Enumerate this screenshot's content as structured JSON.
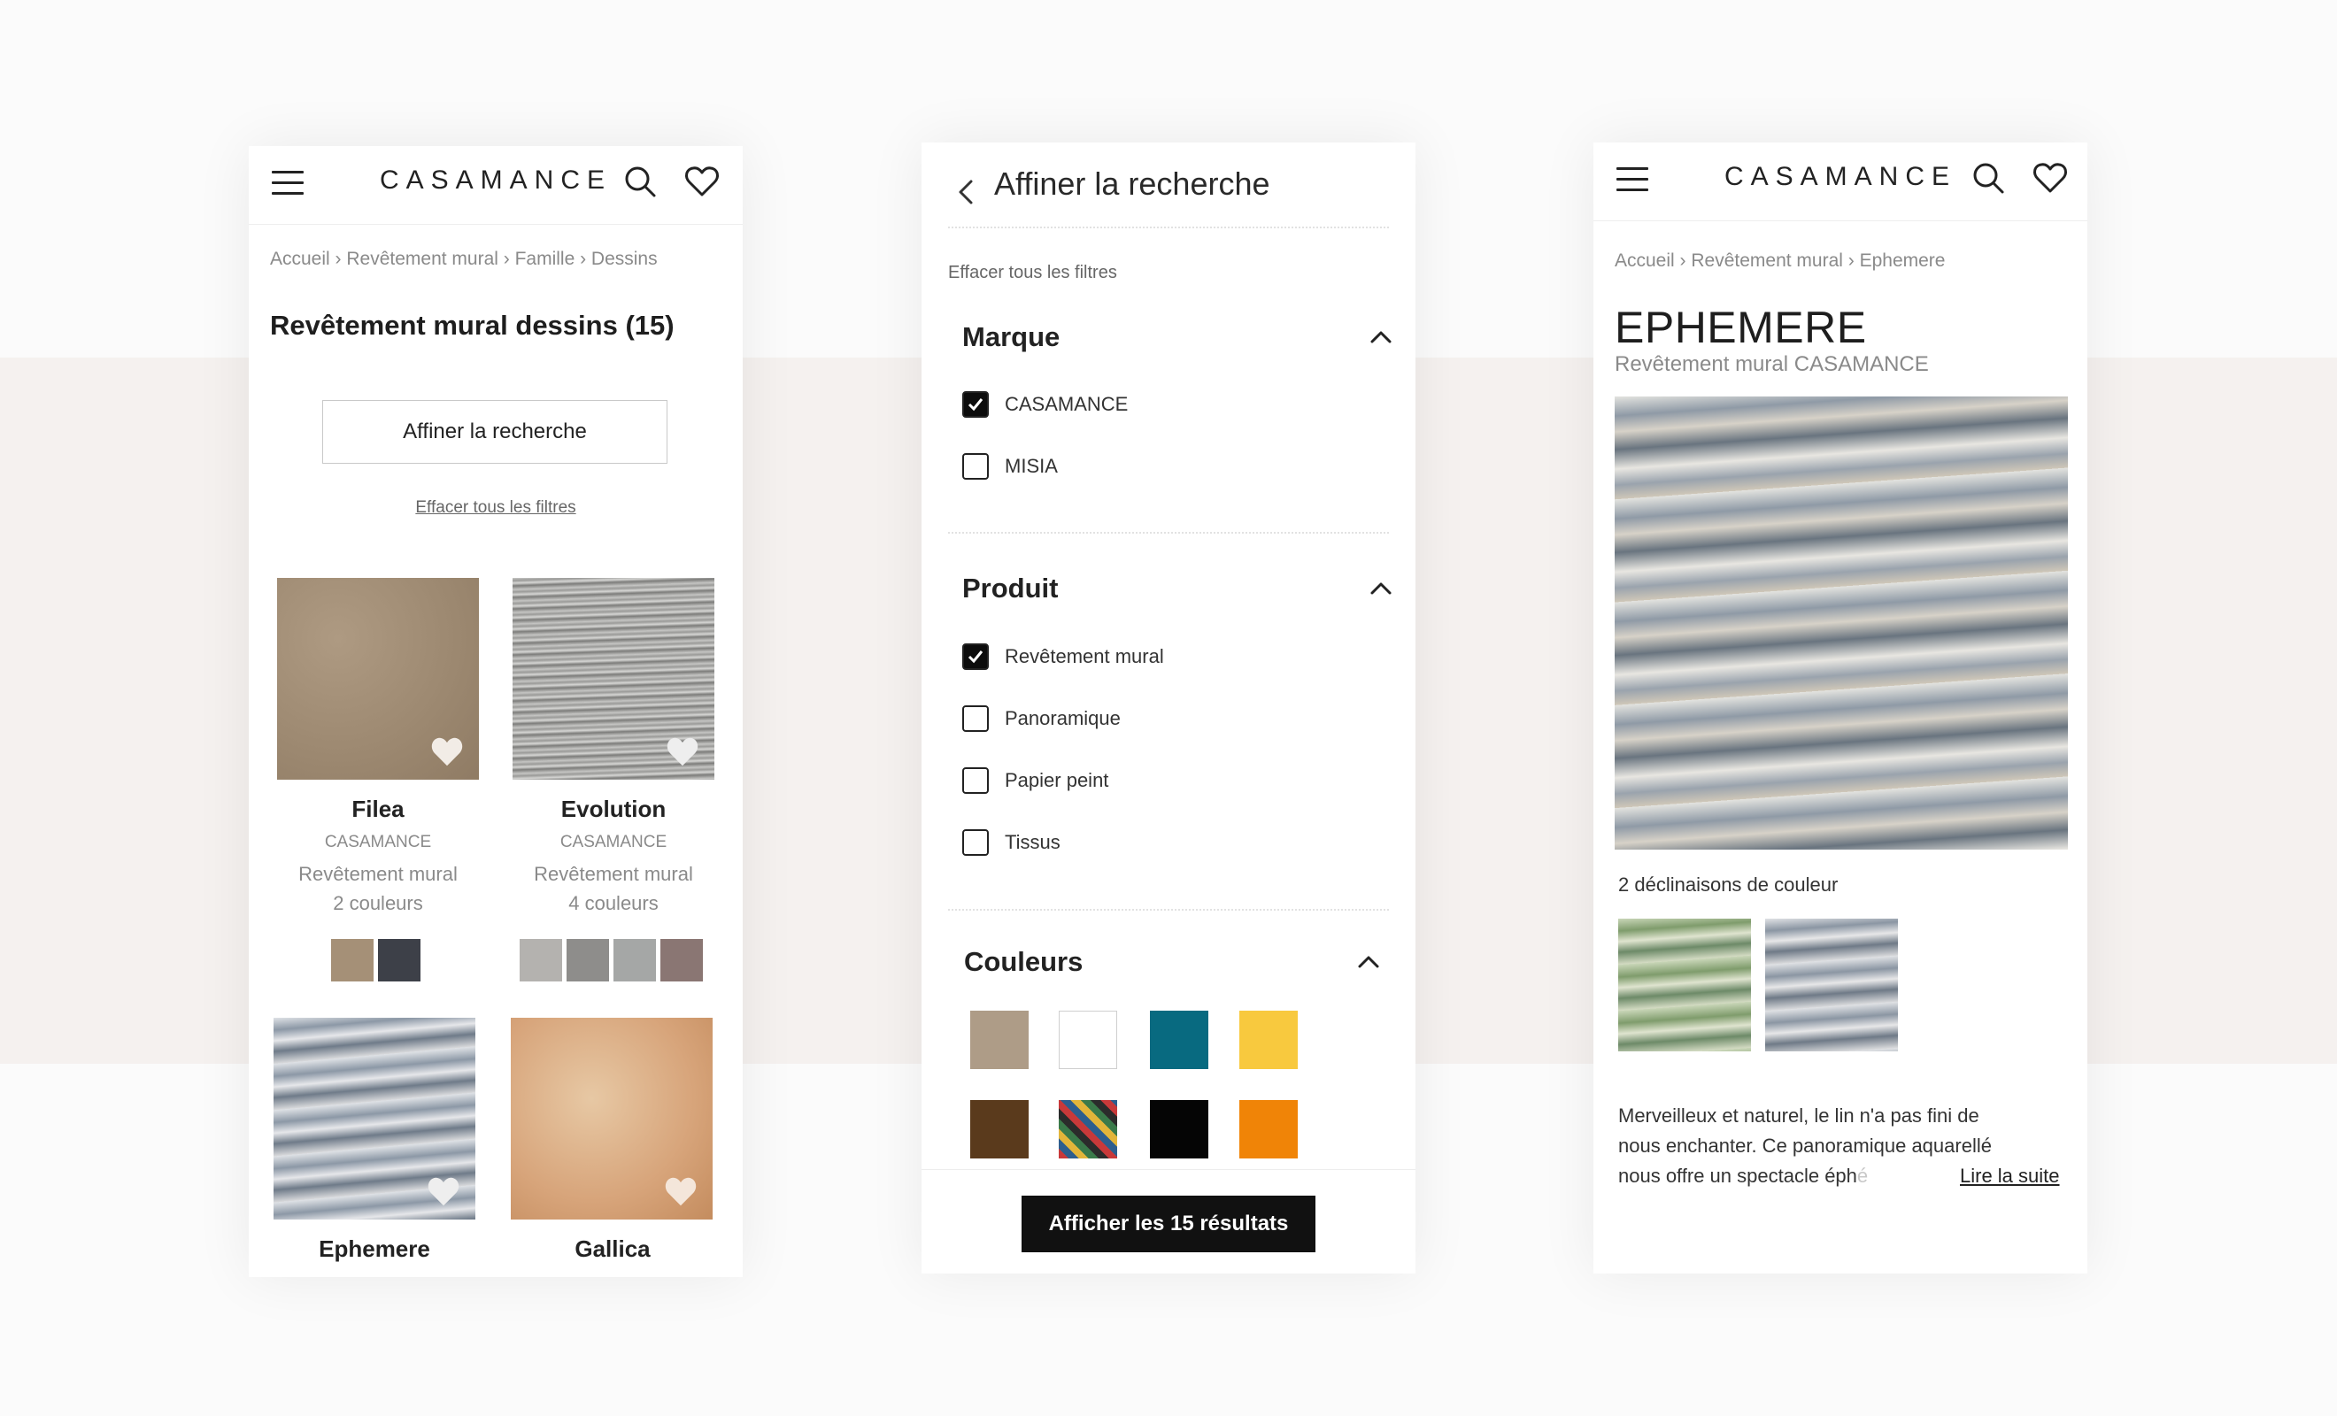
{
  "colors": {
    "accent": "#111111",
    "band": "#f5f1ef"
  },
  "phone1": {
    "logo": "CASAMANCE",
    "icons": [
      "menu-icon",
      "search-icon",
      "heart-icon"
    ],
    "breadcrumb": "Accueil › Revêtement mural › Famille › Dessins",
    "title": "Revêtement mural dessins (15)",
    "refine_button": "Affiner la recherche",
    "clear_filters": "Effacer tous les filtres",
    "products": [
      {
        "name": "Filea",
        "brand": "CASAMANCE",
        "type": "Revêtement mural",
        "colors_label": "2 couleurs",
        "swatches": [
          "#a59077",
          "#3d4048"
        ]
      },
      {
        "name": "Evolution",
        "brand": "CASAMANCE",
        "type": "Revêtement mural",
        "colors_label": "4 couleurs",
        "swatches": [
          "#b4b2af",
          "#8e8d8b",
          "#a5a7a6",
          "#8a7673"
        ]
      },
      {
        "name": "Ephemere"
      },
      {
        "name": "Gallica"
      }
    ]
  },
  "phone2": {
    "title": "Affiner la recherche",
    "clear_filters": "Effacer tous les filtres",
    "sections": {
      "marque": {
        "title": "Marque",
        "options": [
          {
            "label": "CASAMANCE",
            "checked": true
          },
          {
            "label": "MISIA",
            "checked": false
          }
        ]
      },
      "produit": {
        "title": "Produit",
        "options": [
          {
            "label": "Revêtement mural",
            "checked": true
          },
          {
            "label": "Panoramique",
            "checked": false
          },
          {
            "label": "Papier peint",
            "checked": false
          },
          {
            "label": "Tissus",
            "checked": false
          }
        ]
      },
      "couleurs": {
        "title": "Couleurs",
        "swatches": [
          "#ae9c87",
          "#ffffff",
          "#086a80",
          "#f8c93e",
          "#5a3a1c",
          "multicolor",
          "#050505",
          "#f08407"
        ]
      }
    },
    "show_results_button": "Afficher les 15 résultats"
  },
  "phone3": {
    "logo": "CASAMANCE",
    "breadcrumb": "Accueil › Revêtement mural › Ephemere",
    "title": "EPHEMERE",
    "subtitle": "Revêtement mural CASAMANCE",
    "variants_label": "2 déclinaisons de couleur",
    "description_line1": "Merveilleux et naturel, le lin n'a pas fini de",
    "description_line2": "nous enchanter. Ce panoramique aquarellé",
    "description_line3": "nous offre un spectacle éph",
    "description_fade": "é",
    "read_more": "Lire la suite"
  }
}
